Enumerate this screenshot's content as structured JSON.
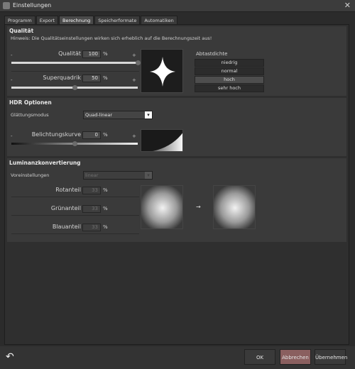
{
  "window": {
    "title": "Einstellungen",
    "close_glyph": "✕"
  },
  "tabs": [
    {
      "label": "Programm"
    },
    {
      "label": "Export"
    },
    {
      "label": "Berechnung"
    },
    {
      "label": "Speicherformate"
    },
    {
      "label": "Automatiken"
    }
  ],
  "active_tab": "Berechnung",
  "quality": {
    "heading": "Qualität",
    "hint": "Hinweis: Die Qualitätseinstellungen wirken sich erheblich auf die Berechnungszeit aus!",
    "qualitaet": {
      "label": "Qualität",
      "value": "100",
      "unit": "%",
      "level": 1.0
    },
    "superquadrik": {
      "label": "Superquadrik",
      "value": "50",
      "unit": "%",
      "level": 0.5
    },
    "minus": "-",
    "plus": "+",
    "density_label": "Abtastdichte",
    "density_options": [
      "niedrig",
      "normal",
      "hoch",
      "sehr hoch"
    ],
    "density_selected": "hoch"
  },
  "hdr": {
    "heading": "HDR Optionen",
    "smoothing_label": "Glättungsmodus",
    "smoothing_value": "Quad-linear",
    "exposure": {
      "label": "Belichtungskurve",
      "value": "0",
      "unit": "%",
      "level": 0.5
    },
    "minus": "-",
    "plus": "+"
  },
  "luminance": {
    "heading": "Luminanzkonvertierung",
    "presets_label": "Voreinstellungen",
    "presets_value": "linear",
    "red": {
      "label": "Rotanteil",
      "value": "33",
      "unit": "%"
    },
    "green": {
      "label": "Grünanteil",
      "value": "33",
      "unit": "%"
    },
    "blue": {
      "label": "Blauanteil",
      "value": "33",
      "unit": "%"
    },
    "arrow": "→"
  },
  "buttons": {
    "undo_glyph": "↶",
    "ok": "OK",
    "cancel": "Abbrechen",
    "apply": "Übernehmen"
  },
  "colors": {
    "cancel_button": "#8a5f5f",
    "ok_button": "#3a3a3a",
    "apply_button": "#3a3a3a"
  }
}
